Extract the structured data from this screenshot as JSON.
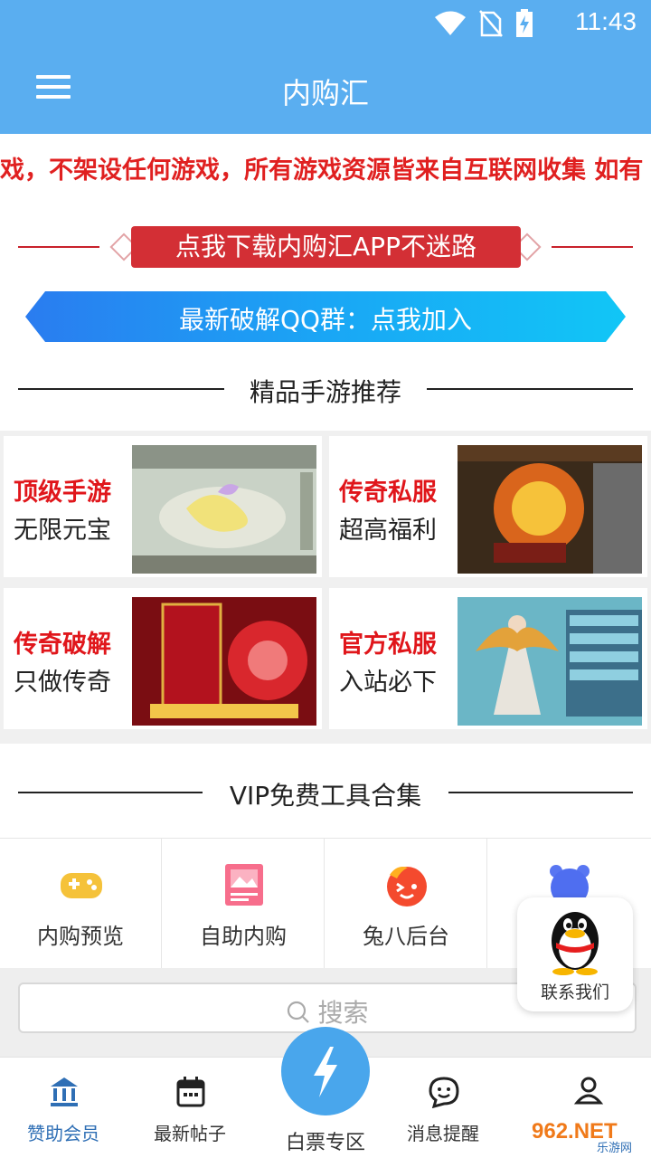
{
  "status": {
    "time": "11:43"
  },
  "appbar": {
    "title": "内购汇"
  },
  "notice": {
    "text": "戏，不架设任何游戏，所有游戏资源皆来自互联网收集 如有"
  },
  "download": {
    "label": "点我下载内购汇APP不迷路"
  },
  "qq_group": {
    "label": "最新破解QQ群：点我加入"
  },
  "recommend": {
    "title": "精品手游推荐",
    "cards": [
      {
        "headline": "顶级手游",
        "sub": "无限元宝"
      },
      {
        "headline": "传奇私服",
        "sub": "超高福利"
      },
      {
        "headline": "传奇破解",
        "sub": "只做传奇"
      },
      {
        "headline": "官方私服",
        "sub": "入站必下"
      }
    ]
  },
  "vip": {
    "title": "VIP免费工具合集",
    "tools": [
      {
        "label": "内购预览",
        "icon": "gamepad-icon"
      },
      {
        "label": "自助内购",
        "icon": "image-card-icon"
      },
      {
        "label": "兔八后台",
        "icon": "mascot-face-icon"
      },
      {
        "label": "",
        "icon": "blue-bear-icon"
      }
    ]
  },
  "search": {
    "placeholder": "搜索"
  },
  "contact": {
    "label": "联系我们"
  },
  "tabbar": {
    "tabs": [
      {
        "label": "赞助会员",
        "icon": "bank-icon"
      },
      {
        "label": "最新帖子",
        "icon": "calendar-icon"
      },
      {
        "label": "白票专区",
        "icon": "lightning-icon"
      },
      {
        "label": "消息提醒",
        "icon": "chat-icon"
      },
      {
        "label": "",
        "icon": "user-icon"
      }
    ]
  },
  "watermark": {
    "text": "962.NET",
    "sub": "乐游网"
  },
  "colors": {
    "primary": "#5aaef0",
    "accent_red": "#e0161b",
    "banner_blue": "#1a9cf2"
  }
}
